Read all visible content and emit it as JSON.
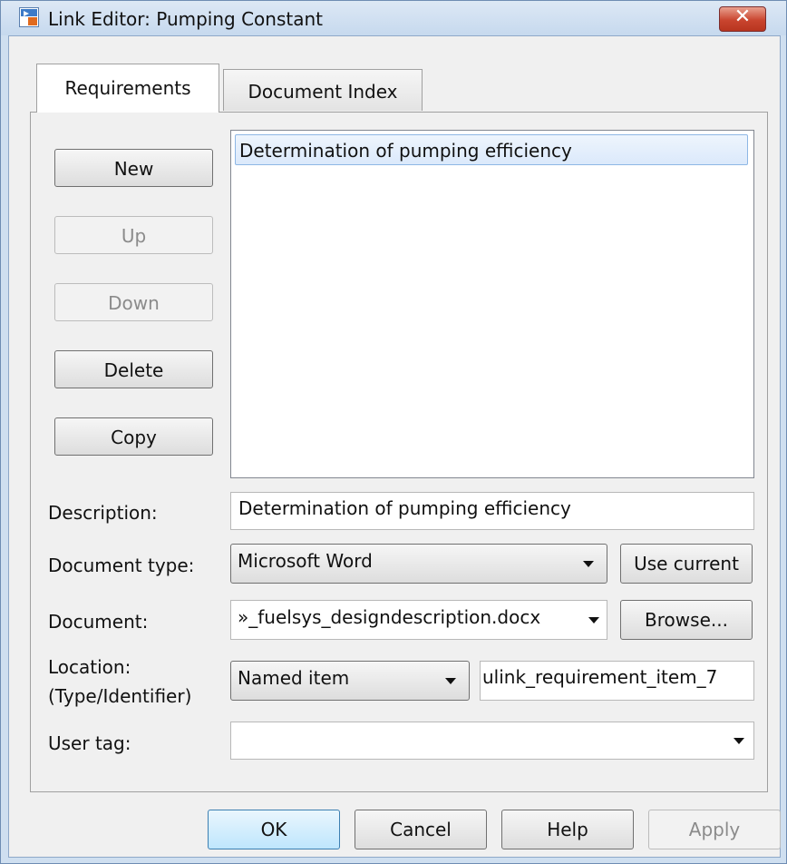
{
  "window": {
    "title": "Link Editor: Pumping Constant"
  },
  "tabs": [
    {
      "label": "Requirements",
      "active": true
    },
    {
      "label": "Document Index",
      "active": false
    }
  ],
  "side_buttons": {
    "new": "New",
    "up": "Up",
    "down": "Down",
    "delete": "Delete",
    "copy": "Copy"
  },
  "requirements_list": {
    "items": [
      "Determination of pumping efficiency"
    ],
    "selected_index": 0
  },
  "form": {
    "description_label": "Description:",
    "description_value": "Determination of pumping efficiency",
    "doc_type_label": "Document type:",
    "doc_type_value": "Microsoft Word",
    "use_current_label": "Use current",
    "document_label": "Document:",
    "document_value": "»_fuelsys_designdescription.docx",
    "browse_label": "Browse...",
    "location_label_1": "Location:",
    "location_label_2": "(Type/Identifier)",
    "location_type_value": "Named item",
    "location_id_value": "ulink_requirement_item_7",
    "user_tag_label": "User tag:",
    "user_tag_value": ""
  },
  "footer": {
    "ok": "OK",
    "cancel": "Cancel",
    "help": "Help",
    "apply": "Apply"
  },
  "icons": {
    "app": "simulink-link-icon",
    "close": "close-icon",
    "dropdown": "chevron-down-icon"
  },
  "colors": {
    "selection": "#dbe9fb",
    "close_button": "#c9452f",
    "title_bar": "#c6d9ee"
  }
}
